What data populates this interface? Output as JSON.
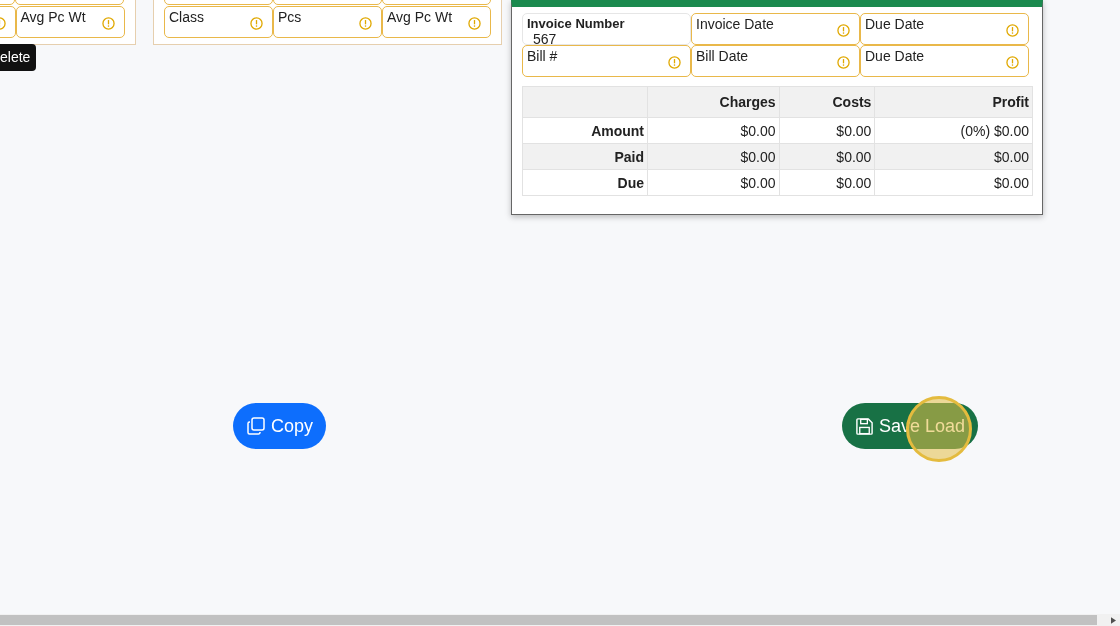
{
  "left_panel": {
    "fields": [
      {
        "required": true
      },
      {
        "label": "Avg Pc Wt",
        "required": true
      }
    ]
  },
  "middle_panel": {
    "fields": [
      {
        "label": "Class",
        "required": true
      },
      {
        "label": "Pcs",
        "required": true
      },
      {
        "label": "Avg Pc Wt",
        "required": true
      }
    ]
  },
  "tooltip": "elete",
  "invoice_panel": {
    "fields": [
      {
        "label": "Invoice Number",
        "value": "567",
        "required": false
      },
      {
        "label": "Invoice Date",
        "required": true
      },
      {
        "label": "Due Date",
        "required": true
      },
      {
        "label": "Bill #",
        "required": true
      },
      {
        "label": "Bill Date",
        "required": true
      },
      {
        "label": "Due Date",
        "required": true
      }
    ],
    "table": {
      "columns": [
        "",
        "Charges",
        "Costs",
        "Profit"
      ],
      "rows": [
        [
          "Amount",
          "$0.00",
          "$0.00",
          "(0%) $0.00"
        ],
        [
          "Paid",
          "$0.00",
          "$0.00",
          "$0.00"
        ],
        [
          "Due",
          "$0.00",
          "$0.00",
          "$0.00"
        ]
      ]
    }
  },
  "buttons": [
    {
      "label": "Copy",
      "kind": "copy"
    },
    {
      "label": "Save Load",
      "kind": "save",
      "clicked": true
    }
  ]
}
